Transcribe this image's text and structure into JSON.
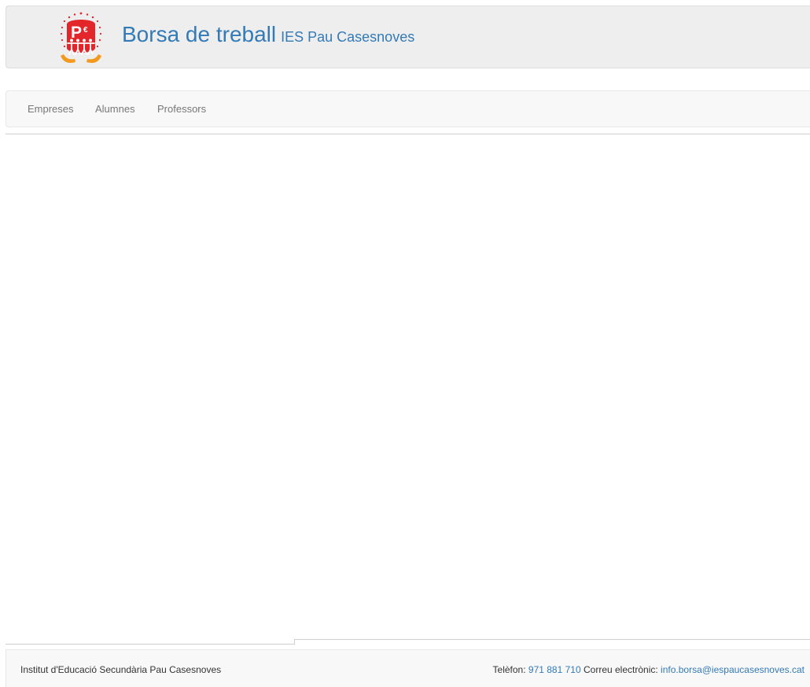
{
  "header": {
    "logo_icon": "ies-pau-casesnoves-logo-icon",
    "title": "Borsa de treball",
    "subtitle": "IES Pau Casesnoves"
  },
  "nav": {
    "items": [
      {
        "label": "Empreses"
      },
      {
        "label": "Alumnes"
      },
      {
        "label": "Professors"
      }
    ]
  },
  "footer": {
    "institution": "Institut d'Educació Secundària Pau Casesnoves",
    "phone_label": "Telèfon:",
    "phone": "971 881 710",
    "email_label": "Correu electrònic:",
    "email": "info.borsa@iespaucasesnoves.cat"
  },
  "colors": {
    "link": "#337ab7",
    "header_bg": "#eeeeee",
    "navbar_bg": "#f8f8f8",
    "nav_text": "#777777",
    "logo_red": "#e2262a",
    "logo_orange": "#f39a1e"
  }
}
